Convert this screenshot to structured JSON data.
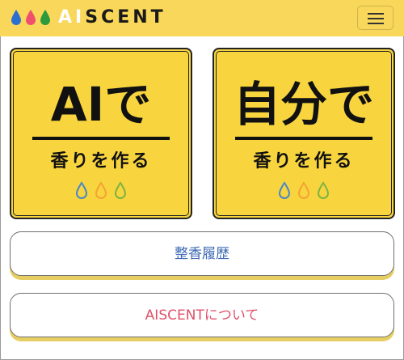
{
  "navbar": {
    "brand_ai": "AI",
    "brand_rest": "SCENT",
    "logo_drop_colors": [
      "#2d6fd0",
      "#f0506e",
      "#2e9a3c"
    ],
    "menu_icon": "hamburger-icon",
    "background": "#f8d75a"
  },
  "cards": [
    {
      "title": "AIで",
      "subtitle": "香りを作る",
      "drop_colors": [
        "#4a86c8",
        "#f5a234",
        "#7cb342"
      ]
    },
    {
      "title": "自分で",
      "subtitle": "香りを作る",
      "drop_colors": [
        "#4a86c8",
        "#f5a234",
        "#7cb342"
      ]
    }
  ],
  "buttons": {
    "history": "整香履歴",
    "about": "AISCENTについて"
  },
  "colors": {
    "card_yellow": "#f8d53e",
    "history_text": "#3d68b3",
    "about_text": "#e0516a",
    "button_shadow": "#e6ce62"
  }
}
